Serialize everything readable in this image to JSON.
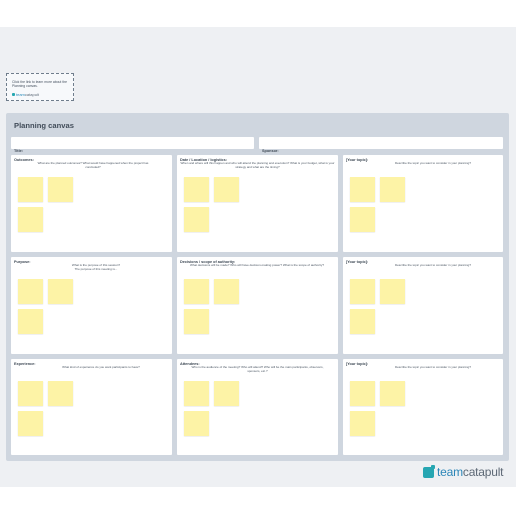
{
  "info_note": {
    "text": "Click the link to learn more about the Planning canvas.",
    "logo_team": "team",
    "logo_catapult": "catapult"
  },
  "canvas": {
    "title": "Planning canvas",
    "fields": {
      "title_label": "Title:",
      "sponsor_label": "Sponsor:"
    },
    "sections": {
      "outcomes": {
        "label": "Outcomes:",
        "prompt": "What are the planned outcomes? What would have happened when the project has concluded?"
      },
      "date": {
        "label": "Date / Location / logistics:",
        "prompt": "When and where will this happen and who will attend the planning and execution? What is your budget, what is your strategy and what are the timing?"
      },
      "topic1": {
        "label": "[Your topic]:",
        "prompt": "Describe the topic you want to consider in your planning?"
      },
      "purpose": {
        "label": "Purpose:",
        "prompt": "What is the purpose of this session?",
        "prompt2": "The purpose of this meeting is..."
      },
      "decisions": {
        "label": "Decisions / scope of authority:",
        "prompt": "What decisions will be made? Who will have decision-making power? What is the scope of authority?"
      },
      "topic2": {
        "label": "[Your topic]:",
        "prompt": "Describe the topic you want to consider in your planning?"
      },
      "experience": {
        "label": "Experience:",
        "prompt": "What kind of experience do you want participants to have?"
      },
      "attendees": {
        "label": "Attendees:",
        "prompt": "Who is the audience of the meeting? Who will attend? Who will be the main participants, observers, sponsors, etc.?"
      },
      "topic3": {
        "label": "[Your topic]:",
        "prompt": "Describe the topic you want to consider in your planning?"
      }
    }
  },
  "brand": {
    "team": "team",
    "catapult": "catapult"
  }
}
